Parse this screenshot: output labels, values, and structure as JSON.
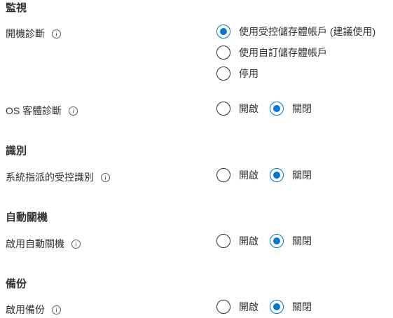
{
  "sections": {
    "monitoring": {
      "title": "監視",
      "boot_diagnostics": {
        "label": "開機診斷",
        "options": [
          "使用受控儲存體帳戶 (建議使用)",
          "使用自訂儲存體帳戶",
          "停用"
        ],
        "selected": "使用受控儲存體帳戶 (建議使用)"
      },
      "os_guest_diagnostics": {
        "label": "OS 客體診斷",
        "options": [
          "開啟",
          "關閉"
        ],
        "selected": "關閉"
      }
    },
    "identity": {
      "title": "識別",
      "managed_identity": {
        "label": "系統指派的受控識別",
        "options": [
          "開啟",
          "關閉"
        ],
        "selected": "關閉"
      }
    },
    "auto_shutdown": {
      "title": "自動關機",
      "enable_auto_shutdown": {
        "label": "啟用自動關機",
        "options": [
          "開啟",
          "關閉"
        ],
        "selected": "關閉"
      }
    },
    "backup": {
      "title": "備份",
      "enable_backup": {
        "label": "啟用備份",
        "options": [
          "開啟",
          "關閉"
        ],
        "selected": "關閉"
      }
    }
  },
  "icons": {
    "info": "info-icon"
  },
  "colors": {
    "accent": "#0078d4",
    "text": "#323130",
    "icon": "#605e5c"
  }
}
